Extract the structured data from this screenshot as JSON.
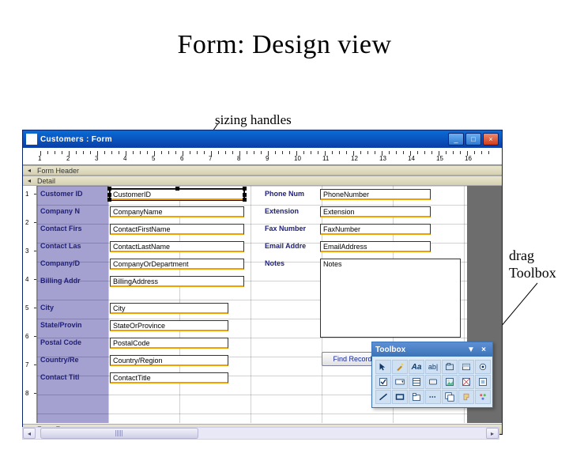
{
  "slide": {
    "title": "Form: Design view"
  },
  "annotations": {
    "sizing": "sizing handles",
    "drag1": "drag",
    "drag2": "Toolbox"
  },
  "window": {
    "title": "Customers : Form",
    "min": "_",
    "max": "□",
    "close": "×"
  },
  "sections": {
    "form_header": "Form Header",
    "detail": "Detail",
    "form_footer": "Form Footer"
  },
  "fields": {
    "left": [
      {
        "label": "Customer ID",
        "value": "CustomerID",
        "selected": true
      },
      {
        "label": "Company N",
        "value": "CompanyName"
      },
      {
        "label": "Contact Firs",
        "value": "ContactFirstName"
      },
      {
        "label": "Contact Las",
        "value": "ContactLastName"
      },
      {
        "label": "Company/D",
        "value": "CompanyOrDepartment"
      },
      {
        "label": "Billing Addr",
        "value": "BillingAddress"
      },
      {
        "label": "City",
        "value": "City"
      },
      {
        "label": "State/Provin",
        "value": "StateOrProvince"
      },
      {
        "label": "Postal Code",
        "value": "PostalCode"
      },
      {
        "label": "Country/Re",
        "value": "Country/Region"
      },
      {
        "label": "Contact Titl",
        "value": "ContactTitle"
      }
    ],
    "right": [
      {
        "label": "Phone Num",
        "value": "PhoneNumber"
      },
      {
        "label": "Extension",
        "value": "Extension"
      },
      {
        "label": "Fax Number",
        "value": "FaxNumber"
      },
      {
        "label": "Email Addre",
        "value": "EmailAddress"
      },
      {
        "label": "Notes",
        "value": "Notes"
      }
    ],
    "button": "Find Record"
  },
  "ruler": {
    "h": [
      "1",
      "2",
      "3",
      "4",
      "5",
      "6",
      "7",
      "8",
      "9",
      "10",
      "11",
      "12",
      "13",
      "14",
      "15",
      "16"
    ],
    "v": [
      "1",
      "2",
      "3",
      "4",
      "5",
      "6",
      "7",
      "8"
    ]
  },
  "scrollbar": {
    "left": "◂",
    "right": "▸"
  },
  "toolbox": {
    "title": "Toolbox",
    "drop": "▼",
    "close": "×",
    "tools": [
      "ptr",
      "wiz",
      "Aa",
      "ab|",
      "grp",
      "tgl",
      "opt",
      "chk",
      "cmb",
      "lst",
      "btn",
      "img",
      "ufr",
      "ubd",
      "line",
      "rect",
      "tab",
      "pgb",
      "sub",
      "more",
      "oth"
    ]
  }
}
